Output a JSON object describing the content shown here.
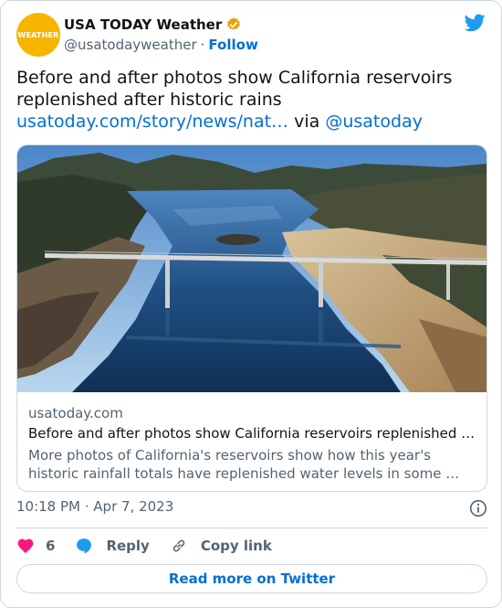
{
  "author": {
    "display_name": "USA TODAY Weather",
    "handle": "@usatodayweather",
    "separator": "·",
    "follow_label": "Follow",
    "avatar_text": "WEATHER",
    "avatar_color": "#f7b500",
    "verified_color": "#e8a20b"
  },
  "tweet": {
    "text": "Before and after photos show California reservoirs replenished after historic rains",
    "link_text": "usatoday.com/story/news/nat…",
    "via_text": "via",
    "mention": "@usatoday"
  },
  "card": {
    "domain": "usatoday.com",
    "title": "Before and after photos show California reservoirs replenished …",
    "description": "More photos of California's reservoirs show how this year's historic rainfall totals have replenished water levels in some …",
    "image": "aerial photo of reservoir with bridge"
  },
  "meta": {
    "timestamp": "10:18 PM · Apr 7, 2023"
  },
  "actions": {
    "like_count": "6",
    "reply_label": "Reply",
    "copy_label": "Copy link"
  },
  "read_more_label": "Read more on Twitter",
  "colors": {
    "link": "#006fd6",
    "like": "#f91880",
    "reply": "#1d9bf0",
    "twitter_bird": "#1d9bf0",
    "border": "#cfd9de",
    "muted": "#536471"
  },
  "icons": {
    "bird": "twitter-bird-icon",
    "verified": "verified-badge-icon",
    "info": "info-icon",
    "like": "heart-icon",
    "reply": "speech-bubble-icon",
    "copy": "link-icon"
  }
}
